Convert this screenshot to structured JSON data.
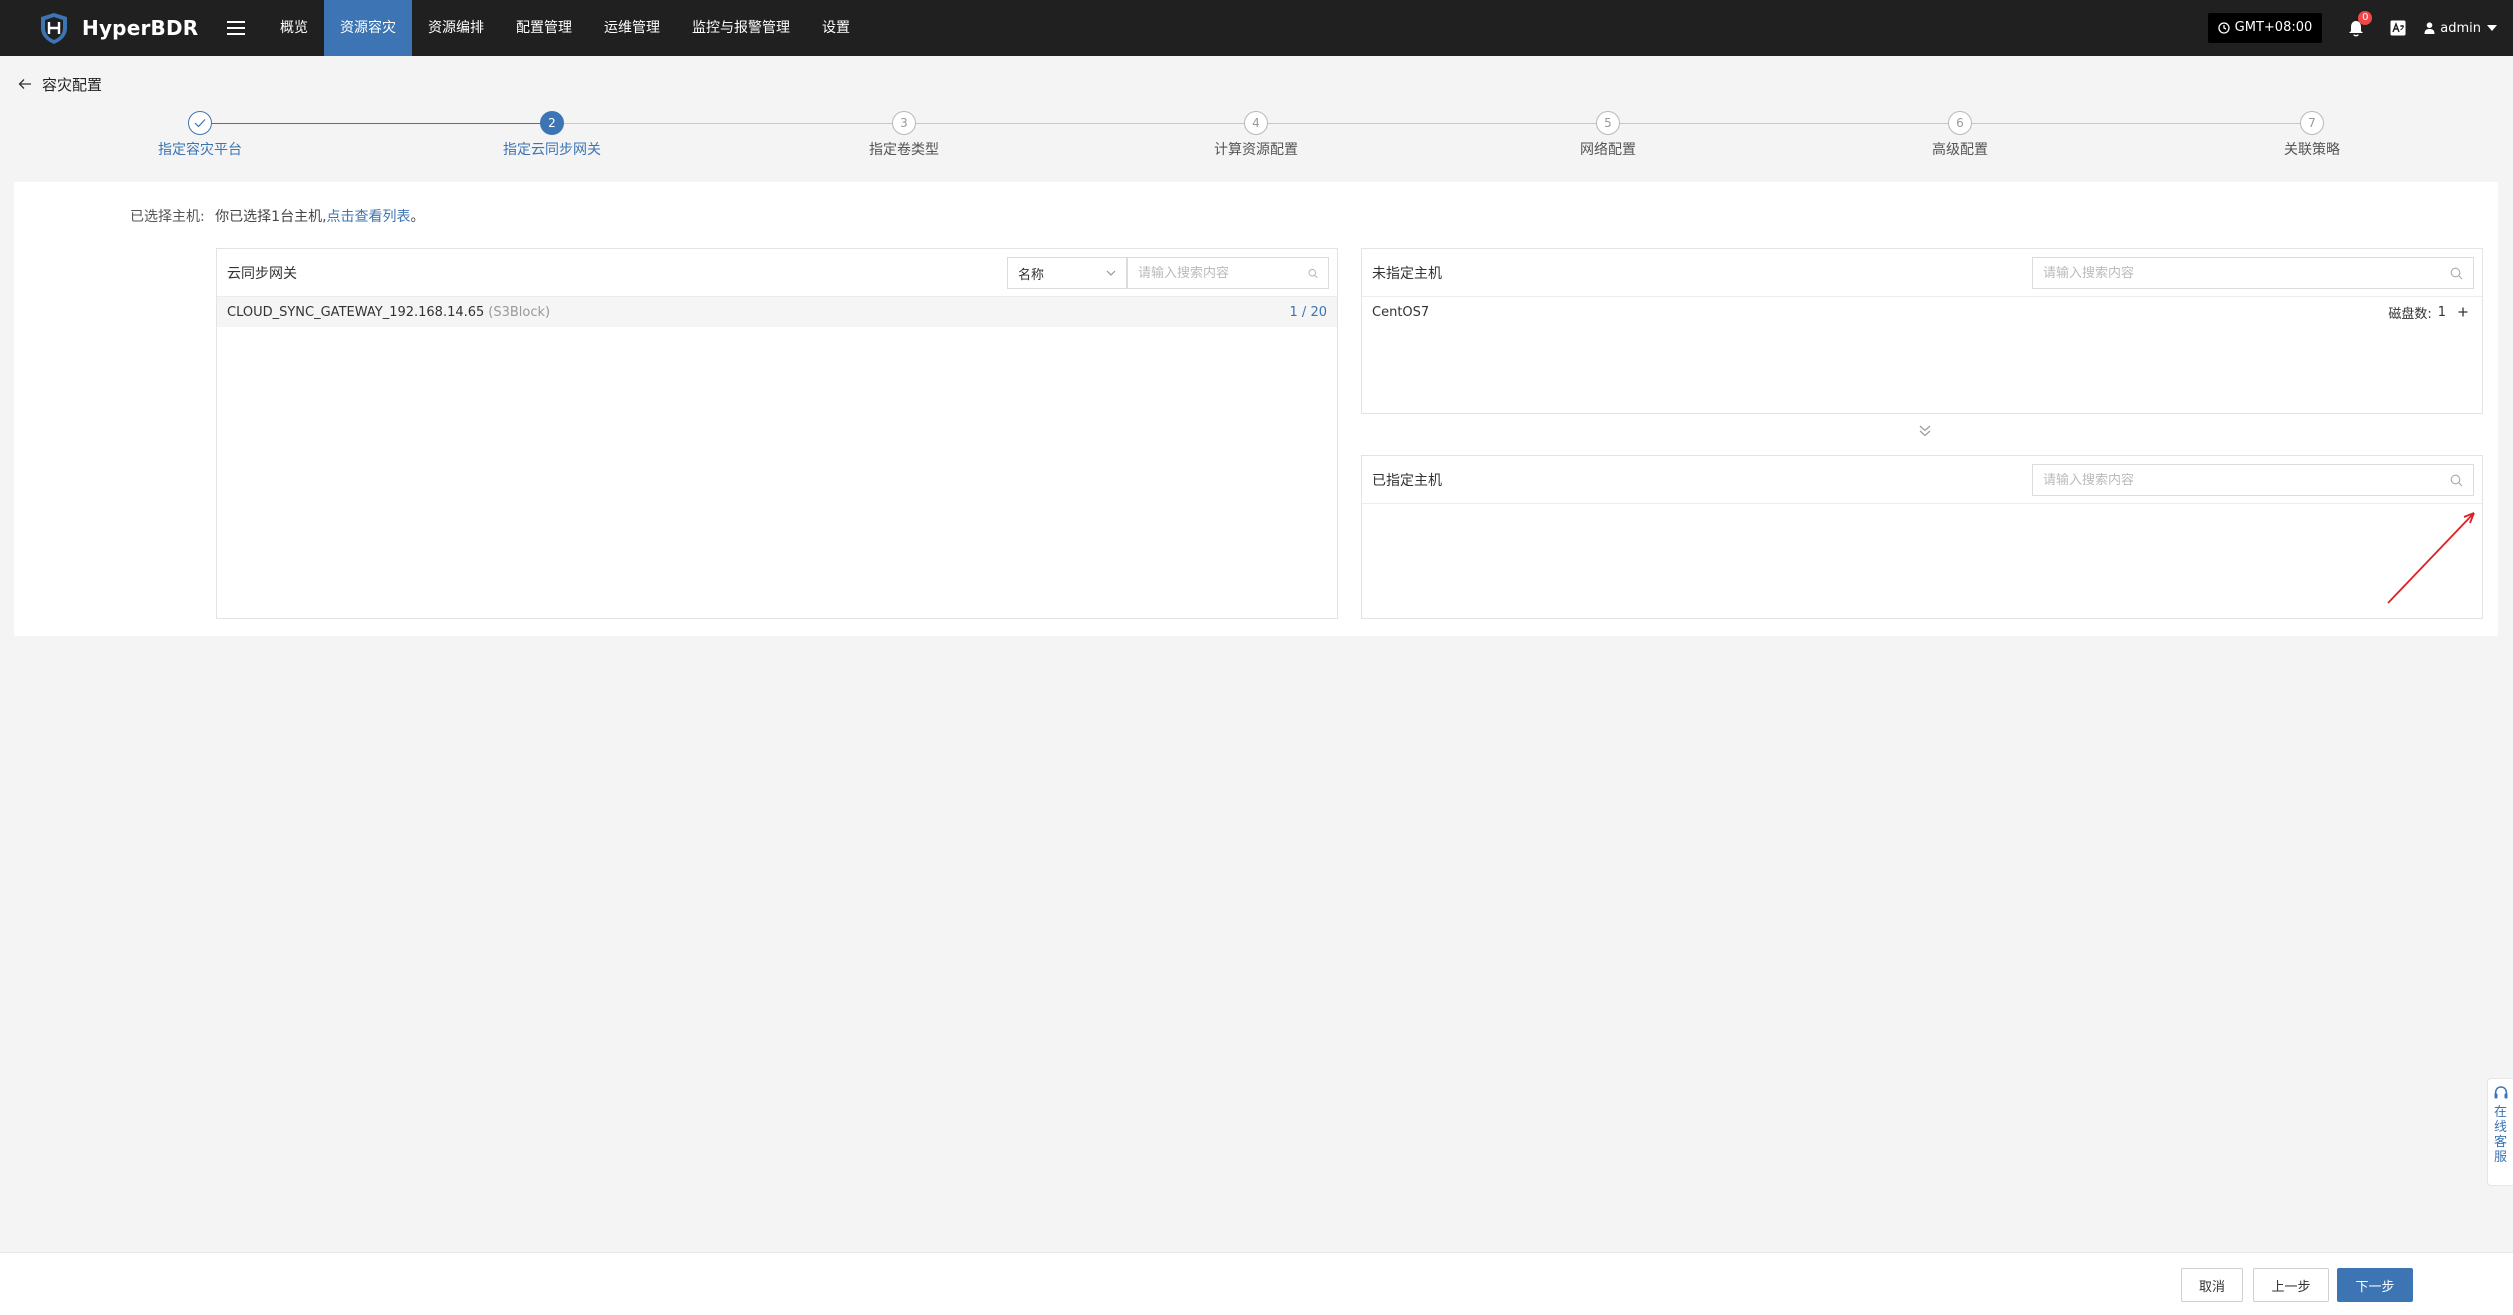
{
  "brand": {
    "name": "HyperBDR"
  },
  "nav": {
    "items": [
      {
        "label": "概览",
        "active": false
      },
      {
        "label": "资源容灾",
        "active": true
      },
      {
        "label": "资源编排",
        "active": false
      },
      {
        "label": "配置管理",
        "active": false
      },
      {
        "label": "运维管理",
        "active": false
      },
      {
        "label": "监控与报警管理",
        "active": false
      },
      {
        "label": "设置",
        "active": false
      }
    ]
  },
  "topright": {
    "timezone": "GMT+08:00",
    "notification_count": "0",
    "lang_icon": "translate-icon",
    "user": "admin"
  },
  "page": {
    "title": "容灾配置"
  },
  "steps": [
    {
      "number": "1",
      "label": "指定容灾平台",
      "state": "done"
    },
    {
      "number": "2",
      "label": "指定云同步网关",
      "state": "current"
    },
    {
      "number": "3",
      "label": "指定卷类型",
      "state": "pending"
    },
    {
      "number": "4",
      "label": "计算资源配置",
      "state": "pending"
    },
    {
      "number": "5",
      "label": "网络配置",
      "state": "pending"
    },
    {
      "number": "6",
      "label": "高级配置",
      "state": "pending"
    },
    {
      "number": "7",
      "label": "关联策略",
      "state": "pending"
    }
  ],
  "selection": {
    "label": "已选择主机:",
    "text": "你已选择1台主机,",
    "link": "点击查看列表",
    "suffix": "。"
  },
  "gateway_panel": {
    "title": "云同步网关",
    "filter_select": "名称",
    "search_placeholder": "请输入搜索内容",
    "rows": [
      {
        "name": "CLOUD_SYNC_GATEWAY_192.168.14.65",
        "tag": "(S3Block)",
        "count": "1 / 20"
      }
    ]
  },
  "unassigned_panel": {
    "title": "未指定主机",
    "search_placeholder": "请输入搜索内容",
    "rows": [
      {
        "name": "CentOS7",
        "disk_label": "磁盘数:",
        "disk_count": "1"
      }
    ]
  },
  "assigned_panel": {
    "title": "已指定主机",
    "search_placeholder": "请输入搜索内容"
  },
  "footer": {
    "cancel": "取消",
    "prev": "上一步",
    "next": "下一步"
  },
  "support": {
    "label": "在线客服"
  },
  "colors": {
    "primary": "#3d74b3",
    "topbar": "#202020",
    "annotation": "#e02020"
  }
}
